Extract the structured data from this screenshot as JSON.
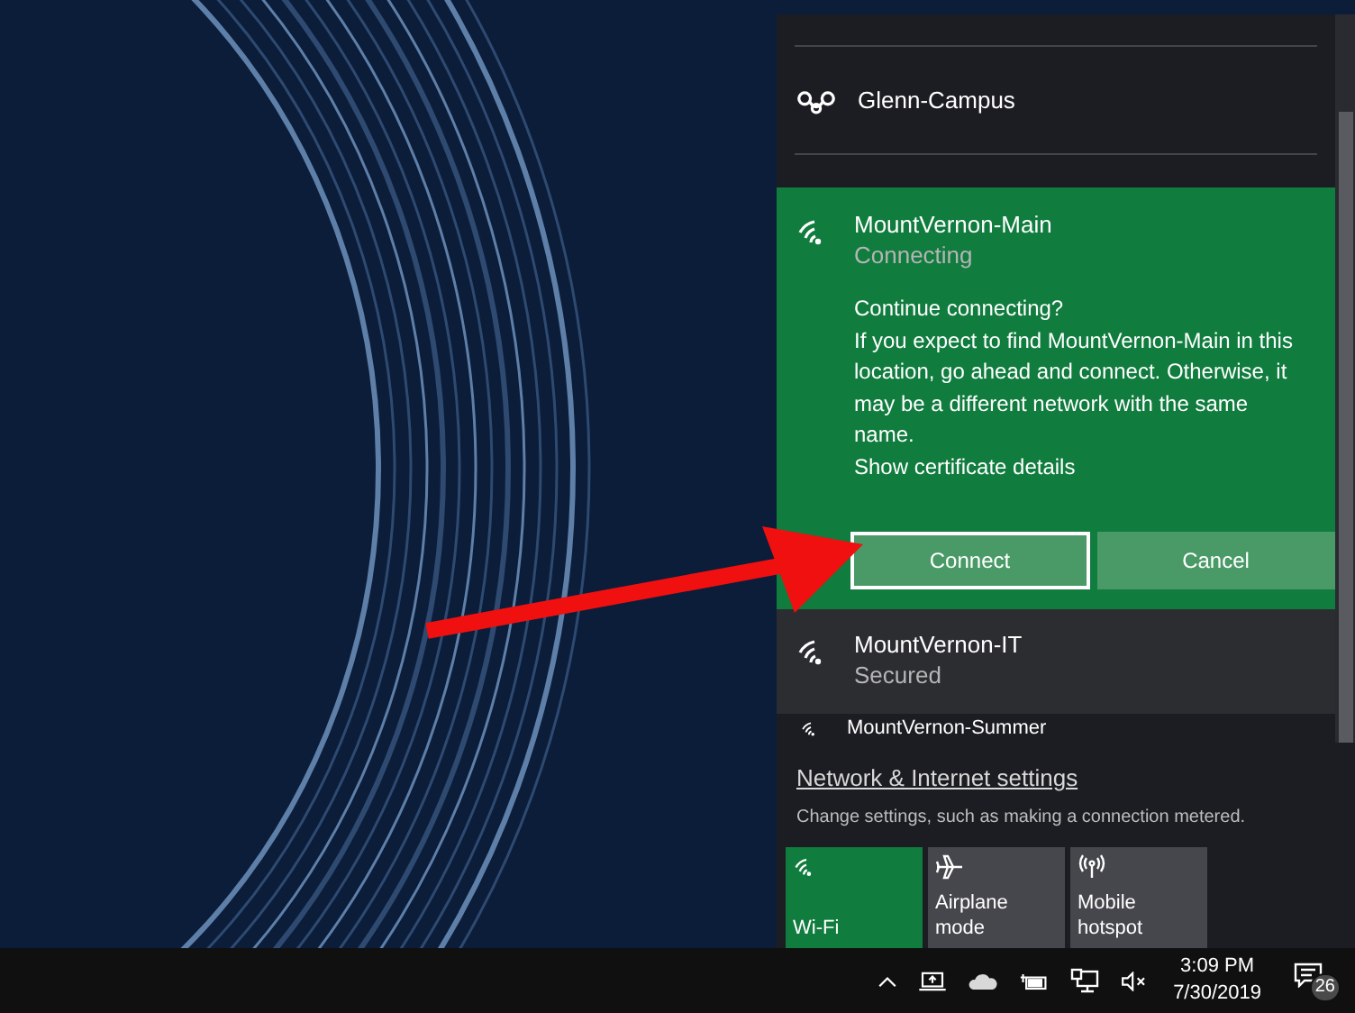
{
  "networks": [
    {
      "name": "Glenn-Campus",
      "kind": "linked",
      "highlighted": false,
      "expanded": false
    },
    {
      "name": "MountVernon-Main",
      "kind": "wifi",
      "status": "Connecting",
      "highlighted": false,
      "expanded": true,
      "prompt": {
        "heading": "Continue connecting?",
        "body": "If you expect to find MountVernon-Main in this location, go ahead and connect. Otherwise, it may be a different network with the same name.",
        "link": "Show certificate details"
      },
      "buttons": [
        {
          "label": "Connect",
          "focused": true
        },
        {
          "label": "Cancel",
          "focused": false
        }
      ]
    },
    {
      "name": "MountVernon-IT",
      "kind": "wifi",
      "status": "Secured",
      "highlighted": true,
      "expanded": false
    },
    {
      "name": "MountVernon-Summer",
      "kind": "wifi",
      "highlighted": false,
      "expanded": false,
      "partial": true
    }
  ],
  "settings_link": "Network & Internet settings",
  "settings_hint": "Change settings, such as making a connection metered.",
  "quick_actions": [
    {
      "label": "Wi-Fi",
      "kind": "wifi",
      "on": true
    },
    {
      "label": "Airplane mode",
      "kind": "airplane",
      "on": false
    },
    {
      "label": "Mobile hotspot",
      "kind": "hotspot",
      "on": false
    }
  ],
  "taskbar": {
    "time": "3:09 PM",
    "date": "7/30/2019",
    "notifications": "26"
  }
}
